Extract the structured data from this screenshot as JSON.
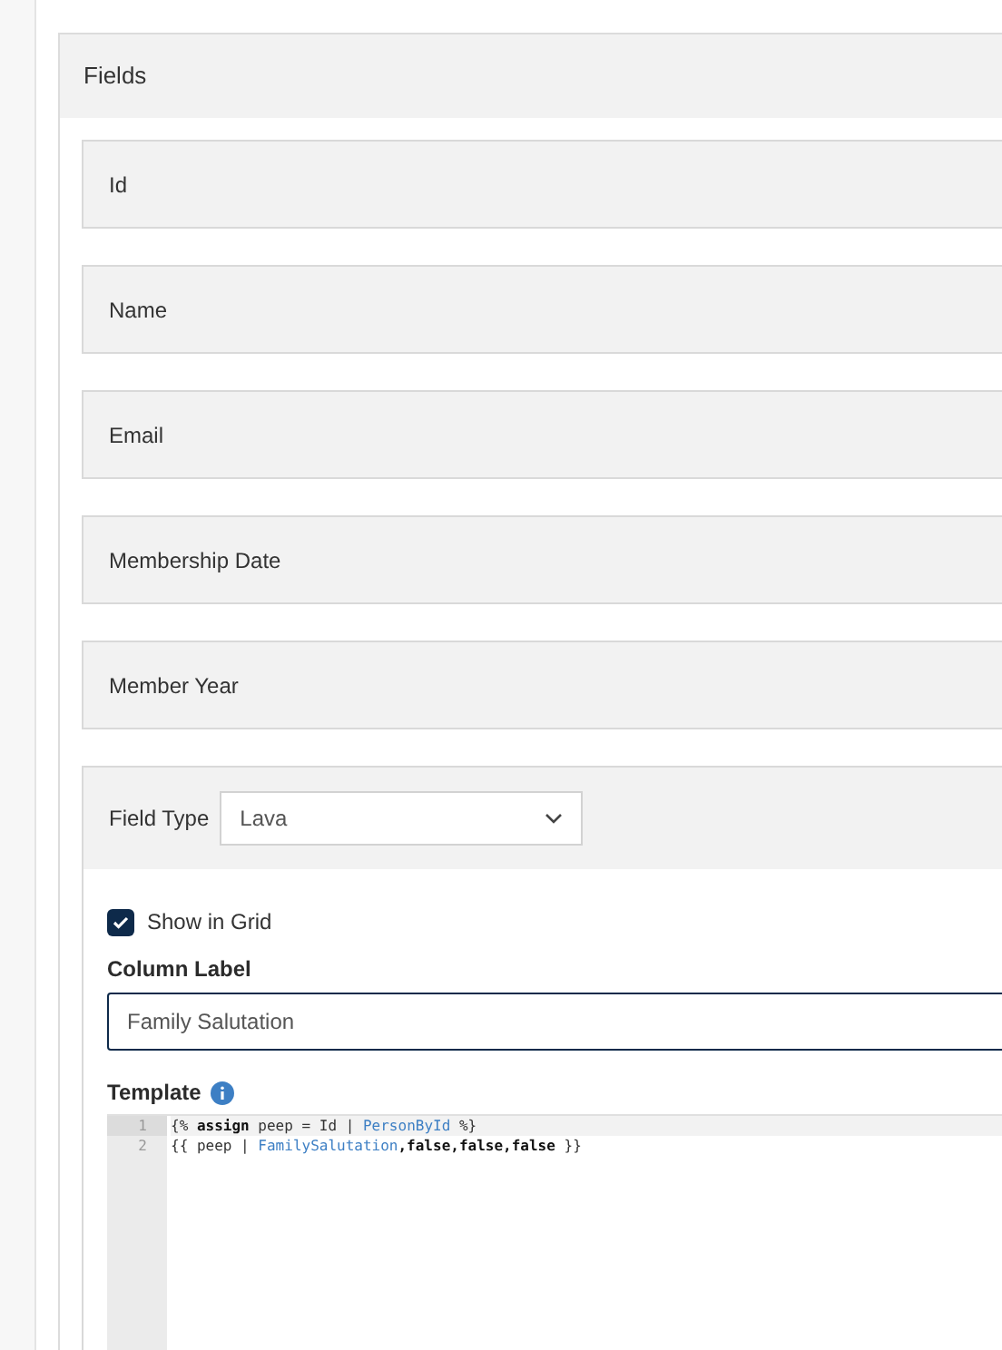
{
  "panel": {
    "title": "Fields"
  },
  "fields": [
    {
      "label": "Id"
    },
    {
      "label": "Name"
    },
    {
      "label": "Email"
    },
    {
      "label": "Membership Date"
    },
    {
      "label": "Member Year"
    }
  ],
  "editor": {
    "field_type_label": "Field Type",
    "field_type_value": "Lava",
    "show_in_grid": {
      "label": "Show in Grid",
      "checked": true
    },
    "column_label": {
      "label": "Column Label",
      "value": "Family Salutation"
    },
    "template": {
      "label": "Template",
      "lines": [
        {
          "number": "1",
          "active": true,
          "tokens": [
            {
              "text": "{% ",
              "kind": "plain"
            },
            {
              "text": "assign",
              "kind": "keyword"
            },
            {
              "text": " peep = Id | ",
              "kind": "plain"
            },
            {
              "text": "PersonById",
              "kind": "filter"
            },
            {
              "text": " %}",
              "kind": "plain"
            }
          ]
        },
        {
          "number": "2",
          "active": false,
          "tokens": [
            {
              "text": "{{ peep | ",
              "kind": "plain"
            },
            {
              "text": "FamilySalutation",
              "kind": "filter"
            },
            {
              "text": ",false,false,false",
              "kind": "keyword"
            },
            {
              "text": " }}",
              "kind": "plain"
            }
          ]
        }
      ]
    }
  }
}
